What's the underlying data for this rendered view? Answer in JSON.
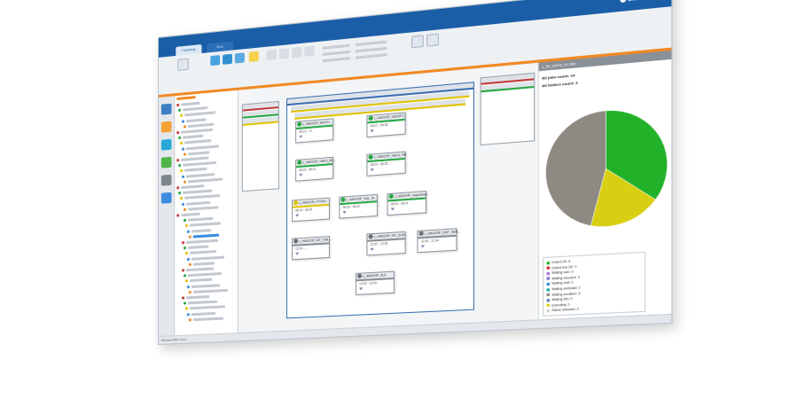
{
  "window": {
    "tab_active": "Planning",
    "tab_other": "Run",
    "brand": "bmc"
  },
  "right_panel": {
    "title": "c_BI_DATA_FLOW",
    "all_jobs_label": "All jobs count:",
    "all_jobs_value": "14",
    "all_folders_label": "All folders count:",
    "all_folders_value": "2"
  },
  "flow_nodes": [
    {
      "label": "c_HADOOP_BATCH...",
      "time": "08:15 - 71",
      "status": "green"
    },
    {
      "label": "c_HADOOP_HDFSFT...",
      "time": "08:17 - 08:18",
      "status": "green"
    },
    {
      "label": "c_HADOOP_HDFS_BE...",
      "time": "08:20 - 08:21",
      "status": "green"
    },
    {
      "label": "c_HADOOP_HDFS_FW",
      "time": "08:24 - 08:25",
      "status": "green"
    },
    {
      "label": "c_HADOOP_PYTHO...",
      "time": "08:19 - 08:20",
      "status": "yellow"
    },
    {
      "label": "c_HADOOP_SQL_HI...",
      "time": "08:20 - 08:22",
      "status": "green"
    },
    {
      "label": "c_HADOOP_mapreduce",
      "time": "08:20 - 08:21",
      "status": "green"
    },
    {
      "label": "c_HADOOP_INT_TUB...",
      "time": "12:33 - ...",
      "status": "grey"
    },
    {
      "label": "c_HADOOP_INT_SCR...",
      "time": "12:32 - 12:33",
      "status": "grey"
    },
    {
      "label": "c_HADOOP_DIST_SER...",
      "time": "12:33 - 12:34",
      "status": "grey"
    },
    {
      "label": "c_HADOOP_SLA",
      "time": "12:33 - 12:43",
      "status": "grey"
    }
  ],
  "chart_data": {
    "type": "pie",
    "categories": [
      "Ended OK",
      "Waiting user",
      "Executing"
    ],
    "values": [
      35,
      19,
      46
    ],
    "colors": [
      "#22b22a",
      "#d9cf12",
      "#8e8982"
    ]
  },
  "legend": [
    {
      "label": "Ended OK: 6",
      "color": "#22b22a"
    },
    {
      "label": "Ended Not OK: 0",
      "color": "#d8232a"
    },
    {
      "label": "Waiting user: 0",
      "color": "#b16ad6"
    },
    {
      "label": "Waiting resource: 0",
      "color": "#7b6bd6"
    },
    {
      "label": "Waiting host: 0",
      "color": "#3b8be0"
    },
    {
      "label": "Waiting workload: 0",
      "color": "#1aa6a6"
    },
    {
      "label": "Waiting condition: 8",
      "color": "#8e8982"
    },
    {
      "label": "Waiting info: 0",
      "color": "#5c7ab8"
    },
    {
      "label": "Executing: 0",
      "color": "#d9cf12"
    },
    {
      "label": "Status unknown: 0",
      "color": "#cfcfcf"
    }
  ],
  "statusbar": {
    "text": "Planning 100% | Find...."
  }
}
